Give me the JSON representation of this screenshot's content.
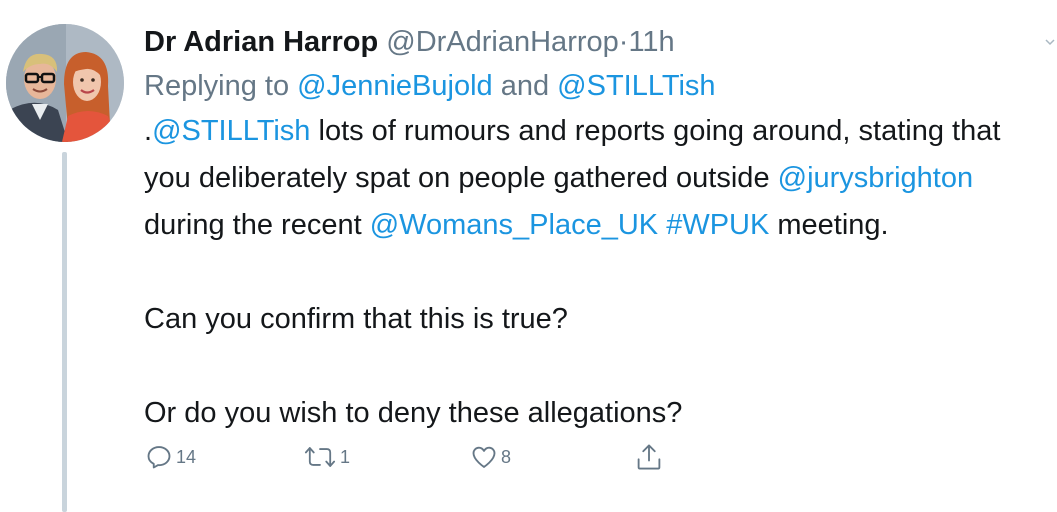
{
  "tweet": {
    "author_name": "Dr Adrian Harrop",
    "author_handle": "@DrAdrianHarrop",
    "separator": "·",
    "time": "11h",
    "reply": {
      "prefix": "Replying to ",
      "user1": "@JennieBujold",
      "conjunction": " and ",
      "user2": "@STILLTish"
    },
    "body": {
      "p1_prefix": ".",
      "p1_mention1": "@STILLTish",
      "p1_text1": " lots of rumours and reports going around, stating that you deliberately spat on people gathered outside ",
      "p1_mention2": "@jurysbrighton",
      "p1_text2": " during the recent ",
      "p1_mention3": "@Womans_Place_UK",
      "p1_space": " ",
      "p1_hashtag": "#WPUK",
      "p1_text3": " meeting.",
      "p2": "Can you confirm that this is true?",
      "p3": "Or do you wish to deny these allegations?"
    },
    "actions": {
      "reply_count": "14",
      "retweet_count": "1",
      "like_count": "8"
    }
  },
  "colors": {
    "link": "#1b95e0",
    "muted": "#657786",
    "text": "#14171a",
    "thread_line": "#c9d4dc"
  },
  "icons": [
    "avatar-photo",
    "caret-down-icon",
    "reply-icon",
    "retweet-icon",
    "like-icon",
    "share-icon"
  ]
}
